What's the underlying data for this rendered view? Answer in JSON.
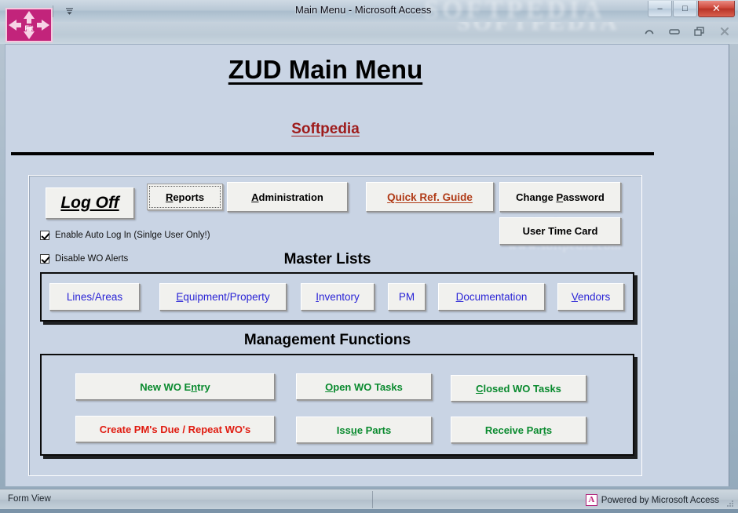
{
  "window": {
    "title": "Main Menu  -  Microsoft Access",
    "watermark": "SOFTPEDIA",
    "watermark_row2": "SOFTPEDIA",
    "form_watermark": "www.softpedia.com",
    "form_watermark2": "Softpedia",
    "quick_access": [
      {
        "name": "redo-icon",
        "glyph": "↷"
      },
      {
        "name": "chevron-down-icon",
        "glyph": "▾"
      },
      {
        "name": "customize-qat-icon",
        "glyph": "☰"
      }
    ],
    "controls": [
      {
        "name": "minimize-button",
        "glyph": "–"
      },
      {
        "name": "maximize-button",
        "glyph": "□"
      },
      {
        "name": "close-button",
        "glyph": "✕"
      }
    ],
    "doc_controls": [
      {
        "name": "collapse-ribbon-button",
        "glyph": "▲"
      },
      {
        "name": "document-minimize-button",
        "glyph": "–"
      },
      {
        "name": "document-restore-button",
        "glyph": "❐"
      },
      {
        "name": "document-close-button",
        "glyph": "✕"
      }
    ],
    "fit_badge_label": "Fit"
  },
  "form": {
    "title": "ZUD Main Menu",
    "subtitle": "Softpedia",
    "top_buttons": [
      {
        "name": "log-off-button",
        "label": "Log Off",
        "accel": "L",
        "style": "logoff"
      },
      {
        "name": "reports-button",
        "label": "Reports",
        "accel": "R",
        "style": "plain",
        "focused": true
      },
      {
        "name": "administration-button",
        "label": "Administration",
        "accel": "A",
        "style": "plain"
      },
      {
        "name": "quick-ref-guide-button",
        "label": "Quick Ref. Guide",
        "accel": "",
        "style": "darkred"
      },
      {
        "name": "change-password-button",
        "label": "Change Password",
        "accel": "P",
        "style": "plain"
      },
      {
        "name": "user-time-card-button",
        "label": "User Time Card",
        "accel": "",
        "style": "plain"
      }
    ],
    "checkboxes": [
      {
        "name": "enable-auto-login-checkbox",
        "label": "Enable Auto Log In (Sinlge User Only!)",
        "checked": true
      },
      {
        "name": "disable-wo-alerts-checkbox",
        "label": "Disable WO Alerts",
        "checked": true
      }
    ],
    "master_lists": {
      "heading": "Master Lists",
      "buttons": [
        {
          "name": "lines-areas-button",
          "label": "Lines/Areas",
          "accel": ""
        },
        {
          "name": "equipment-property-button",
          "label": "Equipment/Property",
          "accel": "E"
        },
        {
          "name": "inventory-button",
          "label": "Inventory",
          "accel": "I"
        },
        {
          "name": "pm-button",
          "label": "PM",
          "accel": ""
        },
        {
          "name": "documentation-button",
          "label": "Documentation",
          "accel": "D"
        },
        {
          "name": "vendors-button",
          "label": "Vendors",
          "accel": "V"
        }
      ]
    },
    "management_functions": {
      "heading": "Management Functions",
      "buttons": [
        {
          "name": "new-wo-entry-button",
          "label": "New WO Entry",
          "accel": "n",
          "color": "green"
        },
        {
          "name": "open-wo-tasks-button",
          "label": "Open WO Tasks",
          "accel": "O",
          "color": "green"
        },
        {
          "name": "closed-wo-tasks-button",
          "label": "Closed WO Tasks",
          "accel": "C",
          "color": "green"
        },
        {
          "name": "create-pms-due-button",
          "label": "Create PM's Due / Repeat WO's",
          "accel": "",
          "color": "red"
        },
        {
          "name": "issue-parts-button",
          "label": "Issue Parts",
          "accel": "u",
          "color": "green"
        },
        {
          "name": "receive-parts-button",
          "label": "Receive Parts",
          "accel": "t",
          "color": "green"
        }
      ]
    }
  },
  "statusbar": {
    "view_mode": "Form View",
    "powered_by": "Powered by Microsoft Access",
    "access_glyph": "A"
  },
  "colors": {
    "form_background": "#c9d4e4",
    "title_black": "#000000",
    "subtitle_red": "#9e1b1b",
    "link_darkred": "#b03a16",
    "master_blue": "#2a24d6",
    "mgmt_green": "#098a2e",
    "mgmt_red": "#e01b10",
    "access_pink": "#c2247b"
  }
}
